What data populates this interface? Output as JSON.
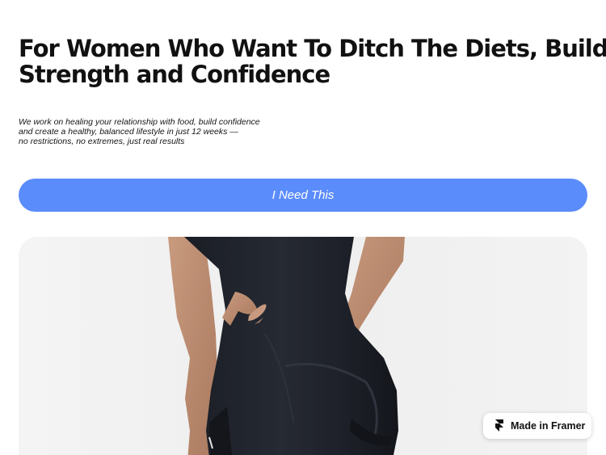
{
  "hero": {
    "headline_line1": "For Women Who Want To Ditch The Diets, Build",
    "headline_line2": "Strength and Confidence",
    "subtext_lines": [
      "We work on healing your relationship with food, build confidence",
      "and create a healthy, balanced lifestyle in just 12 weeks —",
      "no restrictions, no extremes, just real results"
    ],
    "cta_label": "I Need This",
    "image": "woman-in-black-fitted-romper"
  },
  "badge": {
    "label": "Made in Framer",
    "icon": "framer-logo-icon"
  },
  "colors": {
    "cta_background": "#5b8cfb",
    "cta_text": "#ffffff",
    "heading_text": "#111111",
    "page_background": "#ffffff"
  }
}
